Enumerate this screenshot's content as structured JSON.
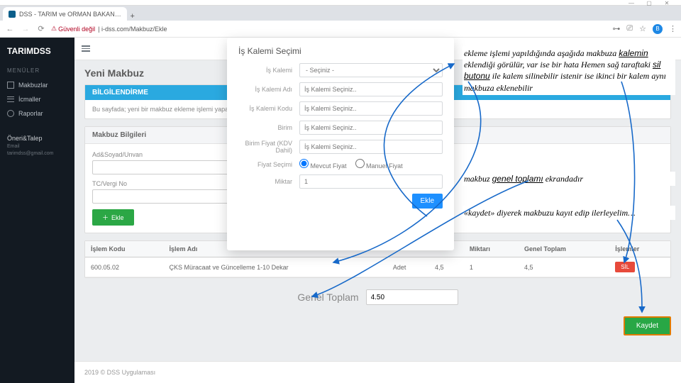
{
  "browser": {
    "tab_title": "DSS - TARIM ve ORMAN BAKAN…",
    "newtab": "+",
    "security": "Güvenli değil",
    "url": "| i-dss.com/Makbuz/Ekle",
    "avatar": "B"
  },
  "sidebar": {
    "logo": "TARIMDSS",
    "section": "MENÜLER",
    "items": [
      {
        "label": "Makbuzlar"
      },
      {
        "label": "İcmaller"
      },
      {
        "label": "Raporlar"
      }
    ],
    "suggest": {
      "title": "Öneri&Talep",
      "email_lbl": "Email",
      "email": "tarimdss@gmail.com"
    }
  },
  "page": {
    "title": "Yeni Makbuz",
    "info_head": "BİLGİLENDİRME",
    "info_body": "Bu sayfada; yeni bir makbuz ekleme işlemi yapabilir ve mevcut kayıtları kesme işlemine devam edebilirsiniz.",
    "receipt_head": "Makbuz Bilgileri",
    "fields": {
      "name": "Ad&Soyad/Unvan",
      "tc": "TC/Vergi No"
    },
    "add_btn": "Ekle",
    "table": {
      "cols": [
        "İşlem Kodu",
        "İşlem Adı",
        "",
        "Miktarı",
        "Genel Toplam",
        "İşlemler"
      ],
      "row": {
        "code": "600.05.02",
        "name": "ÇKS Müracaat ve Güncelleme 1-10 Dekar",
        "unit": "Adet",
        "price": "4,5",
        "qty": "1",
        "total": "4,5",
        "sil": "SİL"
      }
    },
    "gt": {
      "label": "Genel Toplam",
      "value": "4.50"
    },
    "save": "Kaydet",
    "footer": "2019 © DSS Uygulaması"
  },
  "modal": {
    "title": "İş Kalemi Seçimi",
    "rows": {
      "kalemi": "İş Kalemi",
      "kalemi_ph": "- Seçiniz -",
      "adi": "İş Kalemi Adı",
      "adi_ph": "İş Kalemi Seçiniz..",
      "kodu": "İş Kalemi Kodu",
      "kodu_ph": "İş Kalemi Seçiniz..",
      "birim": "Birim",
      "birim_ph": "İş Kalemi Seçiniz..",
      "fiyat": "Birim Fiyat (KDV Dahil)",
      "fiyat_ph": "İş Kalemi Seçiniz..",
      "secim": "Fiyat Seçimi",
      "r1": "Mevcut Fiyat",
      "r2": "Manuel Fiyat",
      "miktar": "Miktar",
      "miktar_v": "1"
    },
    "ekle": "Ekle"
  },
  "notes": {
    "n1": "ekleme işlemi yapıldığında aşağıda makbuza <u>kalemin</u> eklendiği görülür, var ise bir hata Hemen sağ taraftaki <u>sil butonu</u> ile kalem silinebilir istenir ise ikinci bir kalem aynı makbuza eklenebilir",
    "n2": "makbuz <u>genel toplamı</u> ekrandadır",
    "n3": "«kaydet» diyerek makbuzu kayıt edip ilerleyelim…"
  }
}
